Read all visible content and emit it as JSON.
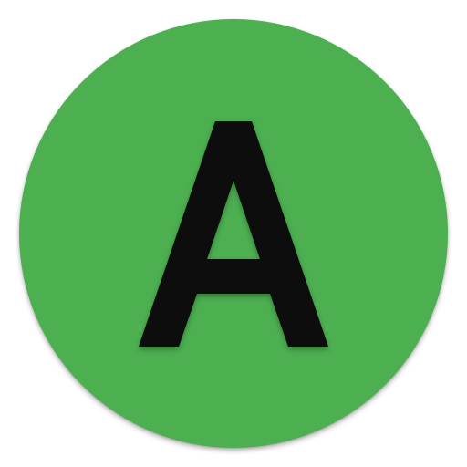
{
  "icon": {
    "name": "letter-a-app-icon",
    "letter": "A",
    "background_color": "#4CAF50",
    "letter_color": "#0a0a0a"
  }
}
